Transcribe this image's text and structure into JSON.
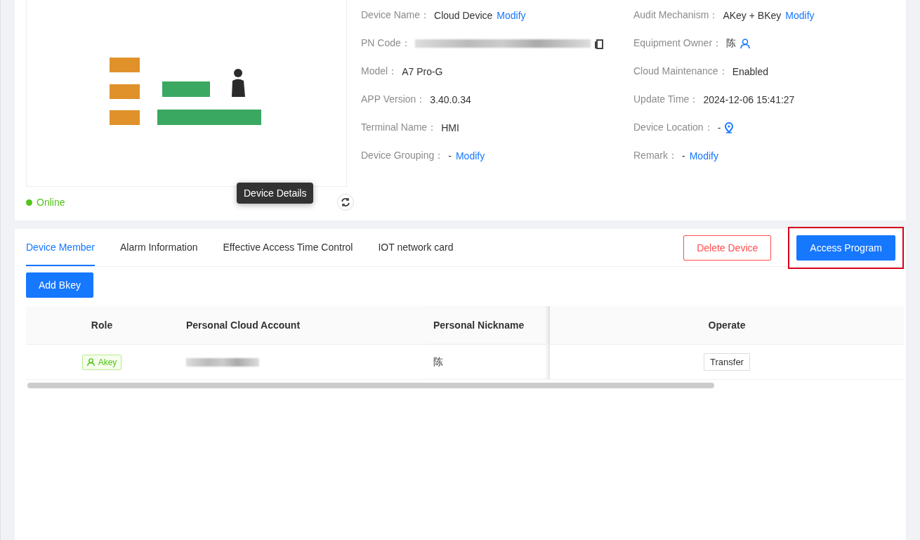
{
  "preview": {
    "status": {
      "label": "Online",
      "online": true
    },
    "tooltip": "Device Details"
  },
  "details": [
    [
      {
        "label": "Device Name：",
        "value": "Cloud Device",
        "link": "Modify"
      },
      {
        "label": "PN Code：",
        "redacted": true,
        "kind": "copy"
      },
      {
        "label": "Model：",
        "value": "A7 Pro-G"
      },
      {
        "label": "APP Version：",
        "value": "3.40.0.34"
      },
      {
        "label": "Terminal Name：",
        "value": "HMI"
      },
      {
        "label": "Device Grouping：",
        "value": "-",
        "link": "Modify"
      }
    ],
    [
      {
        "label": "Audit Mechanism：",
        "value": "AKey + BKey",
        "link": "Modify"
      },
      {
        "label": "Equipment Owner：",
        "value": "陈",
        "kind": "user"
      },
      {
        "label": "Cloud Maintenance：",
        "value": "Enabled"
      },
      {
        "label": "Update Time：",
        "value": "2024-12-06 15:41:27"
      },
      {
        "label": "Device Location：",
        "value": "-",
        "kind": "location"
      },
      {
        "label": "Remark：",
        "value": "-",
        "link": "Modify"
      }
    ]
  ],
  "tabs": [
    {
      "label": "Device Member",
      "selected": true
    },
    {
      "label": "Alarm Information",
      "selected": false
    },
    {
      "label": "Effective Access Time Control",
      "selected": false
    },
    {
      "label": "IOT network card",
      "selected": false
    }
  ],
  "actions": [
    {
      "label": "Delete Device",
      "kind": "danger",
      "highlighted": false
    },
    {
      "label": "Access Program",
      "kind": "primary",
      "highlighted": true
    }
  ],
  "add_button": "Add Bkey",
  "table": {
    "columns": [
      "Role",
      "Personal Cloud Account",
      "Personal Nickname",
      "Operate"
    ],
    "rows": [
      {
        "role": "Akey",
        "account_redacted": true,
        "nickname": "陈",
        "operate": "Transfer"
      }
    ]
  }
}
